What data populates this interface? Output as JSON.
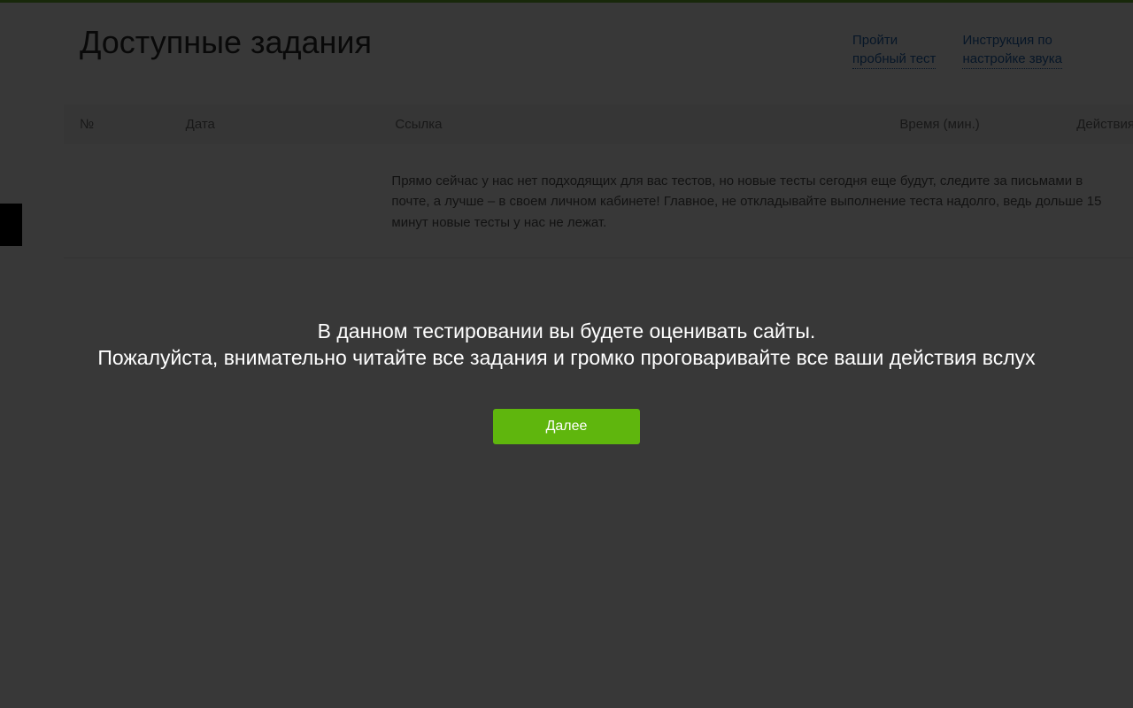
{
  "header": {
    "title": "Доступные задания",
    "links": {
      "trial_test": "Пройти\nпробный тест",
      "audio_instructions": "Инструкция по\nнастройке звука"
    }
  },
  "table": {
    "columns": {
      "num": "№",
      "date": "Дата",
      "link": "Ссылка",
      "time": "Время (мин.)",
      "actions": "Действия"
    },
    "empty_message": "Прямо сейчас у нас нет подходящих для вас тестов, но новые тесты сегодня еще будут, следите за письмами в почте, а лучше – в своем личном кабинете! Главное, не откладывайте выполнение теста надолго, ведь дольше 15 минут новые тесты у нас не лежат."
  },
  "overlay": {
    "line1": "В данном тестировании вы будете оценивать сайты.",
    "line2": "Пожалуйста, внимательно читайте все задания и громко проговаривайте все ваши действия вслух",
    "button": "Далее"
  }
}
